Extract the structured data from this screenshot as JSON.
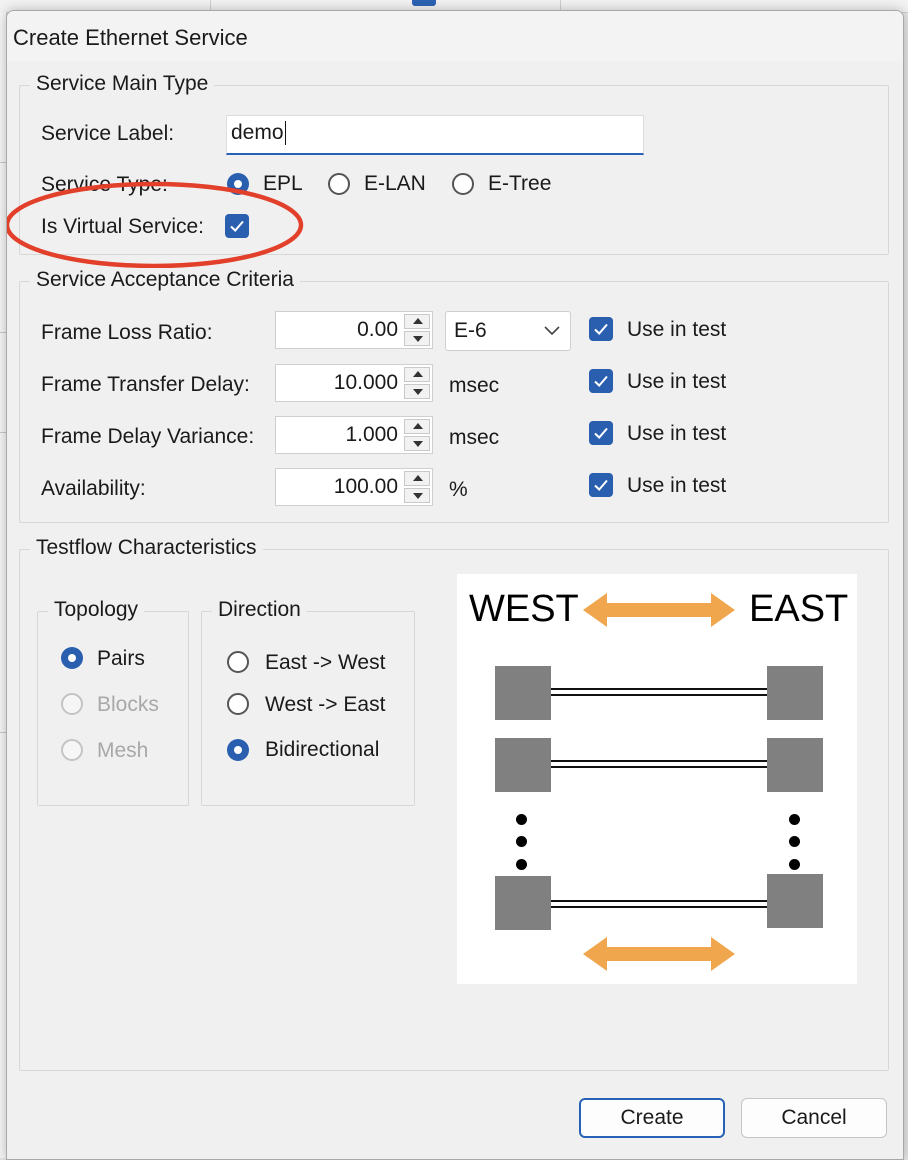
{
  "window": {
    "title": "Create Ethernet Service"
  },
  "service_main_type": {
    "legend": "Service Main Type",
    "label_caption": "Service Label:",
    "label_value": "demo",
    "type_caption": "Service Type:",
    "types": [
      "EPL",
      "E-LAN",
      "E-Tree"
    ],
    "selected_type": "EPL",
    "virtual_caption": "Is Virtual Service:",
    "virtual_checked": true
  },
  "acceptance": {
    "legend": "Service Acceptance Criteria",
    "rows": [
      {
        "label": "Frame Loss Ratio:",
        "value": "0.00",
        "unit": "E-6",
        "unit_is_dropdown": true,
        "use_label": "Use in test",
        "use_checked": true
      },
      {
        "label": "Frame Transfer Delay:",
        "value": "10.000",
        "unit": "msec",
        "use_label": "Use in test",
        "use_checked": true
      },
      {
        "label": "Frame Delay Variance:",
        "value": "1.000",
        "unit": "msec",
        "use_label": "Use in test",
        "use_checked": true
      },
      {
        "label": "Availability:",
        "value": "100.00",
        "unit": "%",
        "use_label": "Use in test",
        "use_checked": true
      }
    ]
  },
  "testflow": {
    "legend": "Testflow Characteristics",
    "topology": {
      "legend": "Topology",
      "options": [
        {
          "label": "Pairs",
          "selected": true,
          "enabled": true
        },
        {
          "label": "Blocks",
          "selected": false,
          "enabled": false
        },
        {
          "label": "Mesh",
          "selected": false,
          "enabled": false
        }
      ]
    },
    "direction": {
      "legend": "Direction",
      "options": [
        {
          "label": "East -> West",
          "selected": false
        },
        {
          "label": "West -> East",
          "selected": false
        },
        {
          "label": "Bidirectional",
          "selected": true
        }
      ]
    },
    "diagram": {
      "west": "WEST",
      "east": "EAST"
    }
  },
  "buttons": {
    "create": "Create",
    "cancel": "Cancel"
  },
  "colors": {
    "accent": "#2a5fb0",
    "arrow": "#f0a64d",
    "annotation": "#e2402a",
    "node": "#808080"
  }
}
